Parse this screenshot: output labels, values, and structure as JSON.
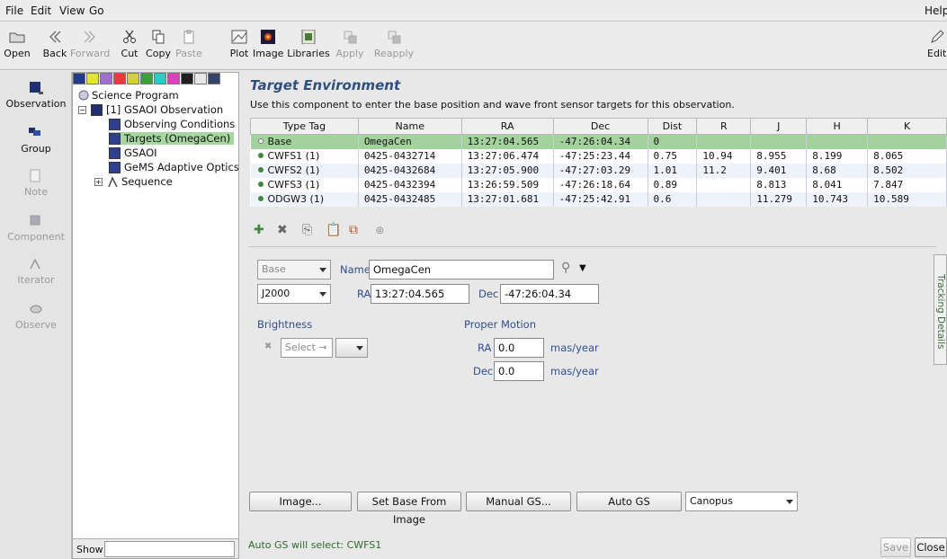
{
  "menu": {
    "file": "File",
    "edit": "Edit",
    "view": "View",
    "go": "Go",
    "help": "Help"
  },
  "toolbar": {
    "open": "Open",
    "back": "Back",
    "forward": "Forward",
    "cut": "Cut",
    "copy": "Copy",
    "paste": "Paste",
    "plot": "Plot",
    "image": "Image",
    "libraries": "Libraries",
    "apply": "Apply",
    "reapply": "Reapply",
    "edit": "Edit"
  },
  "palette": {
    "observation": "Observation",
    "group": "Group",
    "note": "Note",
    "component": "Component",
    "iterator": "Iterator",
    "observe": "Observe"
  },
  "tree": {
    "root": "Science Program",
    "observation": "[1] GSAOI Observation",
    "items": [
      "Observing Conditions",
      "Targets (OmegaCen)",
      "GSAOI",
      "GeMS Adaptive Optics",
      "Sequence"
    ],
    "show_label": "Show"
  },
  "panel": {
    "title": "Target Environment",
    "description": "Use this component to enter the base position and wave front sensor targets for this observation."
  },
  "table": {
    "headers": [
      "Type Tag",
      "Name",
      "RA",
      "Dec",
      "Dist",
      "R",
      "J",
      "H",
      "K"
    ],
    "rows": [
      {
        "tag": "Base",
        "name": "OmegaCen",
        "ra": "13:27:04.565",
        "dec": "-47:26:04.34",
        "dist": "0",
        "r": "",
        "j": "",
        "h": "",
        "k": ""
      },
      {
        "tag": "CWFS1 (1)",
        "name": "0425-0432714",
        "ra": "13:27:06.474",
        "dec": "-47:25:23.44",
        "dist": "0.75",
        "r": "10.94",
        "j": "8.955",
        "h": "8.199",
        "k": "8.065"
      },
      {
        "tag": "CWFS2 (1)",
        "name": "0425-0432684",
        "ra": "13:27:05.900",
        "dec": "-47:27:03.29",
        "dist": "1.01",
        "r": "11.2",
        "j": "9.401",
        "h": "8.68",
        "k": "8.502"
      },
      {
        "tag": "CWFS3 (1)",
        "name": "0425-0432394",
        "ra": "13:26:59.509",
        "dec": "-47:26:18.64",
        "dist": "0.89",
        "r": "",
        "j": "8.813",
        "h": "8.041",
        "k": "7.847"
      },
      {
        "tag": "ODGW3 (1)",
        "name": "0425-0432485",
        "ra": "13:27:01.681",
        "dec": "-47:25:42.91",
        "dist": "0.6",
        "r": "",
        "j": "11.279",
        "h": "10.743",
        "k": "10.589"
      }
    ]
  },
  "form": {
    "type_value": "Base",
    "name_label": "Name",
    "name_value": "OmegaCen",
    "coord_system": "J2000",
    "ra_label": "RA",
    "ra_value": "13:27:04.565",
    "dec_label": "Dec",
    "dec_value": "-47:26:04.34",
    "brightness_label": "Brightness",
    "brightness_select": "Select →",
    "proper_motion_label": "Proper Motion",
    "pm_ra_label": "RA",
    "pm_ra_value": "0.0",
    "pm_dec_label": "Dec",
    "pm_dec_value": "0.0",
    "units": "mas/year",
    "tracking_tab": "Tracking Details"
  },
  "buttons": {
    "image": "Image...",
    "set_base": "Set Base From Image",
    "manual_gs": "Manual GS...",
    "auto_gs": "Auto GS",
    "catalog": "Canopus",
    "save": "Save",
    "close": "Close"
  },
  "status": "Auto GS will select: CWFS1"
}
